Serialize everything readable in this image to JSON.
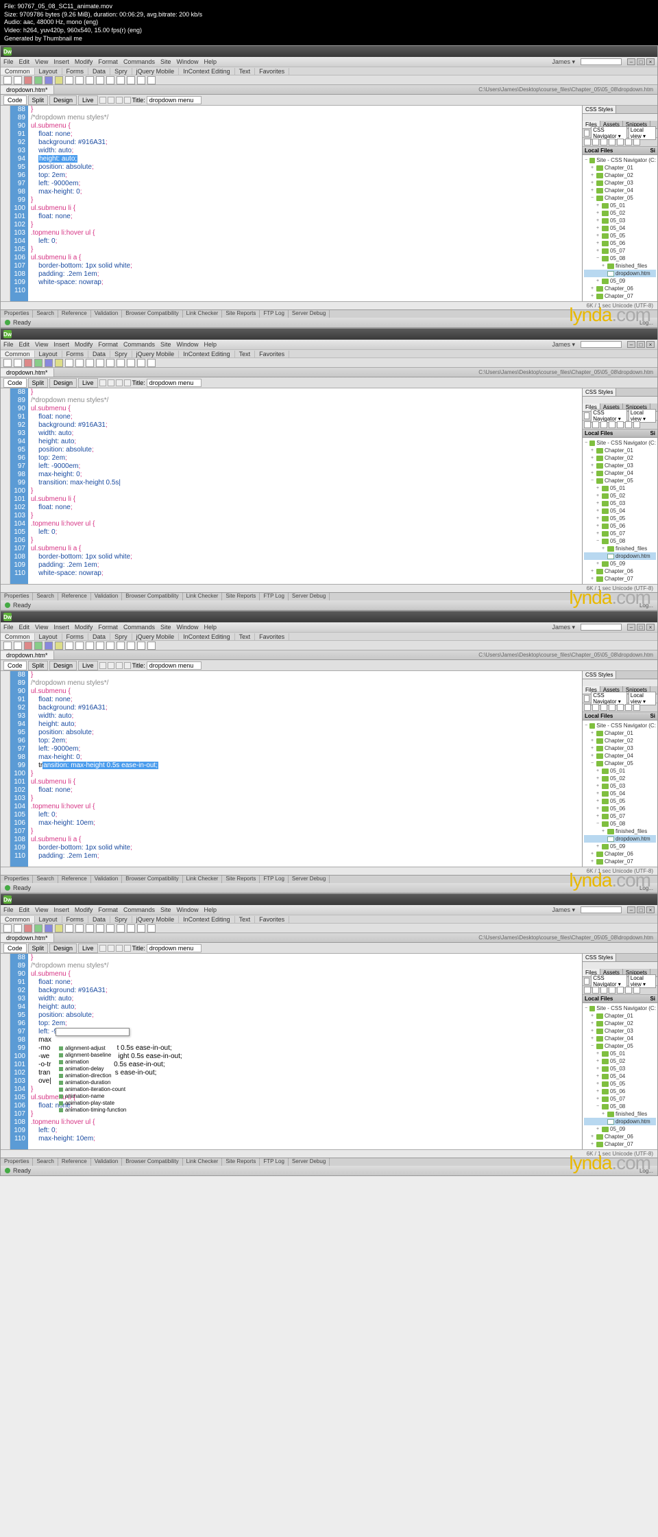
{
  "terminal": {
    "l1": "File: 90767_05_08_SC11_animate.mov",
    "l2": "Size: 9709786 bytes (9.26 MiB), duration: 00:06:29, avg.bitrate: 200 kb/s",
    "l3": "Audio: aac, 48000 Hz, mono (eng)",
    "l4": "Video: h264, yuv420p, 960x540, 15.00 fps(r) (eng)",
    "l5": "Generated by Thumbnail me"
  },
  "menu": {
    "items": [
      "File",
      "Edit",
      "View",
      "Insert",
      "Modify",
      "Format",
      "Commands",
      "Site",
      "Window",
      "Help"
    ],
    "user": "James"
  },
  "insert": {
    "tabs": [
      "Common",
      "Layout",
      "Forms",
      "Data",
      "Spry",
      "jQuery Mobile",
      "InContext Editing",
      "Text",
      "Favorites"
    ]
  },
  "doc": {
    "tab": "dropdown.htm*",
    "path": "C:\\Users\\James\\Desktop\\course_files\\Chapter_05\\05_08\\dropdown.htm"
  },
  "view": {
    "btns": [
      "Code",
      "Split",
      "Design",
      "Live"
    ],
    "title_label": "Title:",
    "title_value": "dropdown menu"
  },
  "panels": {
    "css_tab": "CSS Styles",
    "side_tabs": [
      "Files",
      "Assets",
      "Snippets"
    ],
    "nav_label": "CSS Navigator",
    "scope": "Local view",
    "files_hdr": "Local Files",
    "site_root": "Site - CSS Navigator (C:\\Use...",
    "tree": [
      "Chapter_01",
      "Chapter_02",
      "Chapter_03",
      "Chapter_04",
      "Chapter_05"
    ],
    "ch5": [
      "05_01",
      "05_02",
      "05_03",
      "05_04",
      "05_05",
      "05_06",
      "05_07",
      "05_08"
    ],
    "ff": "finished_files",
    "dd": "dropdown.htm",
    "_09": "05_09",
    "rest": [
      "Chapter_06",
      "Chapter_07"
    ],
    "si": "Si"
  },
  "status": {
    "text": "6K / 1 sec  Unicode (UTF-8)"
  },
  "bottom": {
    "tabs": [
      "Properties",
      "Search",
      "Reference",
      "Validation",
      "Browser Compatibility",
      "Link Checker",
      "Site Reports",
      "FTP Log",
      "Server Debug"
    ],
    "ready": "Ready",
    "log": "Log..."
  },
  "wm": {
    "brand": "lynda",
    "dom": ".com"
  },
  "code1": {
    "start": 88,
    "lines": [
      "}",
      "/*dropdown menu styles*/",
      "ul.submenu {",
      "    float: none;",
      "    background: #916A31;",
      "    width: auto;",
      "    height: auto;",
      "    position: absolute;",
      "    top: 2em;",
      "    left: -9000em;",
      "    max-height: 0;",
      "}",
      "ul.submenu li {",
      "    float: none;",
      "}",
      ".topmenu li:hover ul {",
      "    left: 0;",
      "}",
      "ul.submenu li a {",
      "    border-bottom: 1px solid white;",
      "    padding: .2em 1em;",
      "    white-space: nowrap;",
      ""
    ],
    "highlight_line": 94,
    "highlight_text": "height: auto;"
  },
  "code2": {
    "start": 88,
    "lines": [
      "}",
      "/*dropdown menu styles*/",
      "ul.submenu {",
      "    float: none;",
      "    background: #916A31;",
      "    width: auto;",
      "    height: auto;",
      "    position: absolute;",
      "    top: 2em;",
      "    left: -9000em;",
      "    max-height: 0;",
      "    transition: max-height 0.5s|",
      "}",
      "ul.submenu li {",
      "    float: none;",
      "}",
      ".topmenu li:hover ul {",
      "    left: 0;",
      "}",
      "ul.submenu li a {",
      "    border-bottom: 1px solid white;",
      "    padding: .2em 1em;",
      "    white-space: nowrap;"
    ]
  },
  "code3": {
    "start": 88,
    "lines": [
      "}",
      "/*dropdown menu styles*/",
      "ul.submenu {",
      "    float: none;",
      "    background: #916A31;",
      "    width: auto;",
      "    height: auto;",
      "    position: absolute;",
      "    top: 2em;",
      "    left: -9000em;",
      "    max-height: 0;",
      "    transition: max-height 0.5s ease-in-out;",
      "}",
      "ul.submenu li {",
      "    float: none;",
      "}",
      ".topmenu li:hover ul {",
      "    left: 0;",
      "    max-height: 10em;",
      "}",
      "ul.submenu li a {",
      "    border-bottom: 1px solid white;",
      "    padding: .2em 1em;"
    ],
    "highlight_line": 99,
    "highlight_text": "ansition: max-height 0.5s ease-in-out;"
  },
  "code4": {
    "start": 88,
    "lines": [
      "}",
      "/*dropdown menu styles*/",
      "ul.submenu {",
      "    float: none;",
      "    background: #916A31;",
      "    width: auto;",
      "    height: auto;",
      "    position: absolute;",
      "    top: 2em;",
      "    left: -9000em;",
      "    max-height: 0;",
      "    -moz-transition: max-height 0.5s ease-in-out;",
      "    -webkit-transition: max-height 0.5s ease-in-out;",
      "    -o-transition: max-height 0.5s ease-in-out;",
      "    transition: max-height 0.5s ease-in-out;",
      "    ove|",
      "}",
      "ul.submenu li {",
      "    float: none;",
      "}",
      ".topmenu li:hover ul {",
      "    left: 0;",
      "    max-height: 10em;"
    ],
    "autocomplete": [
      "alignment-adjust",
      "alignment-baseline",
      "animation",
      "animation-delay",
      "animation-direction",
      "animation-duration",
      "animation-iteration-count",
      "animation-name",
      "animation-play-state",
      "animation-timing-function"
    ]
  }
}
